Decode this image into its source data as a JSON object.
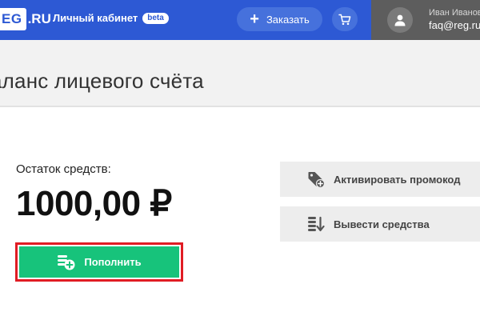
{
  "header": {
    "logo_main": "EG",
    "logo_suffix": ".RU",
    "cabinet_label": "Личный кабинет",
    "beta_badge": "beta",
    "order_label": "Заказать",
    "user_name": "Иван Иванов",
    "user_email": "faq@reg.ru"
  },
  "page": {
    "title": "аланс лицевого счёта"
  },
  "balance": {
    "label": "Остаток средств:",
    "amount": "1000,00 ₽",
    "topup_label": "Пополнить"
  },
  "actions": {
    "promo_label": "Активировать промокод",
    "withdraw_label": "Вывести средства"
  },
  "colors": {
    "header_bg": "#2d59d4",
    "primary_green": "#17c37b",
    "highlight_red": "#e01c24"
  },
  "icons": {
    "order": "plus-icon",
    "cart": "cart-icon",
    "avatar": "user-icon",
    "topup": "coins-plus-icon",
    "promo": "tag-plus-icon",
    "withdraw": "coins-down-icon"
  }
}
